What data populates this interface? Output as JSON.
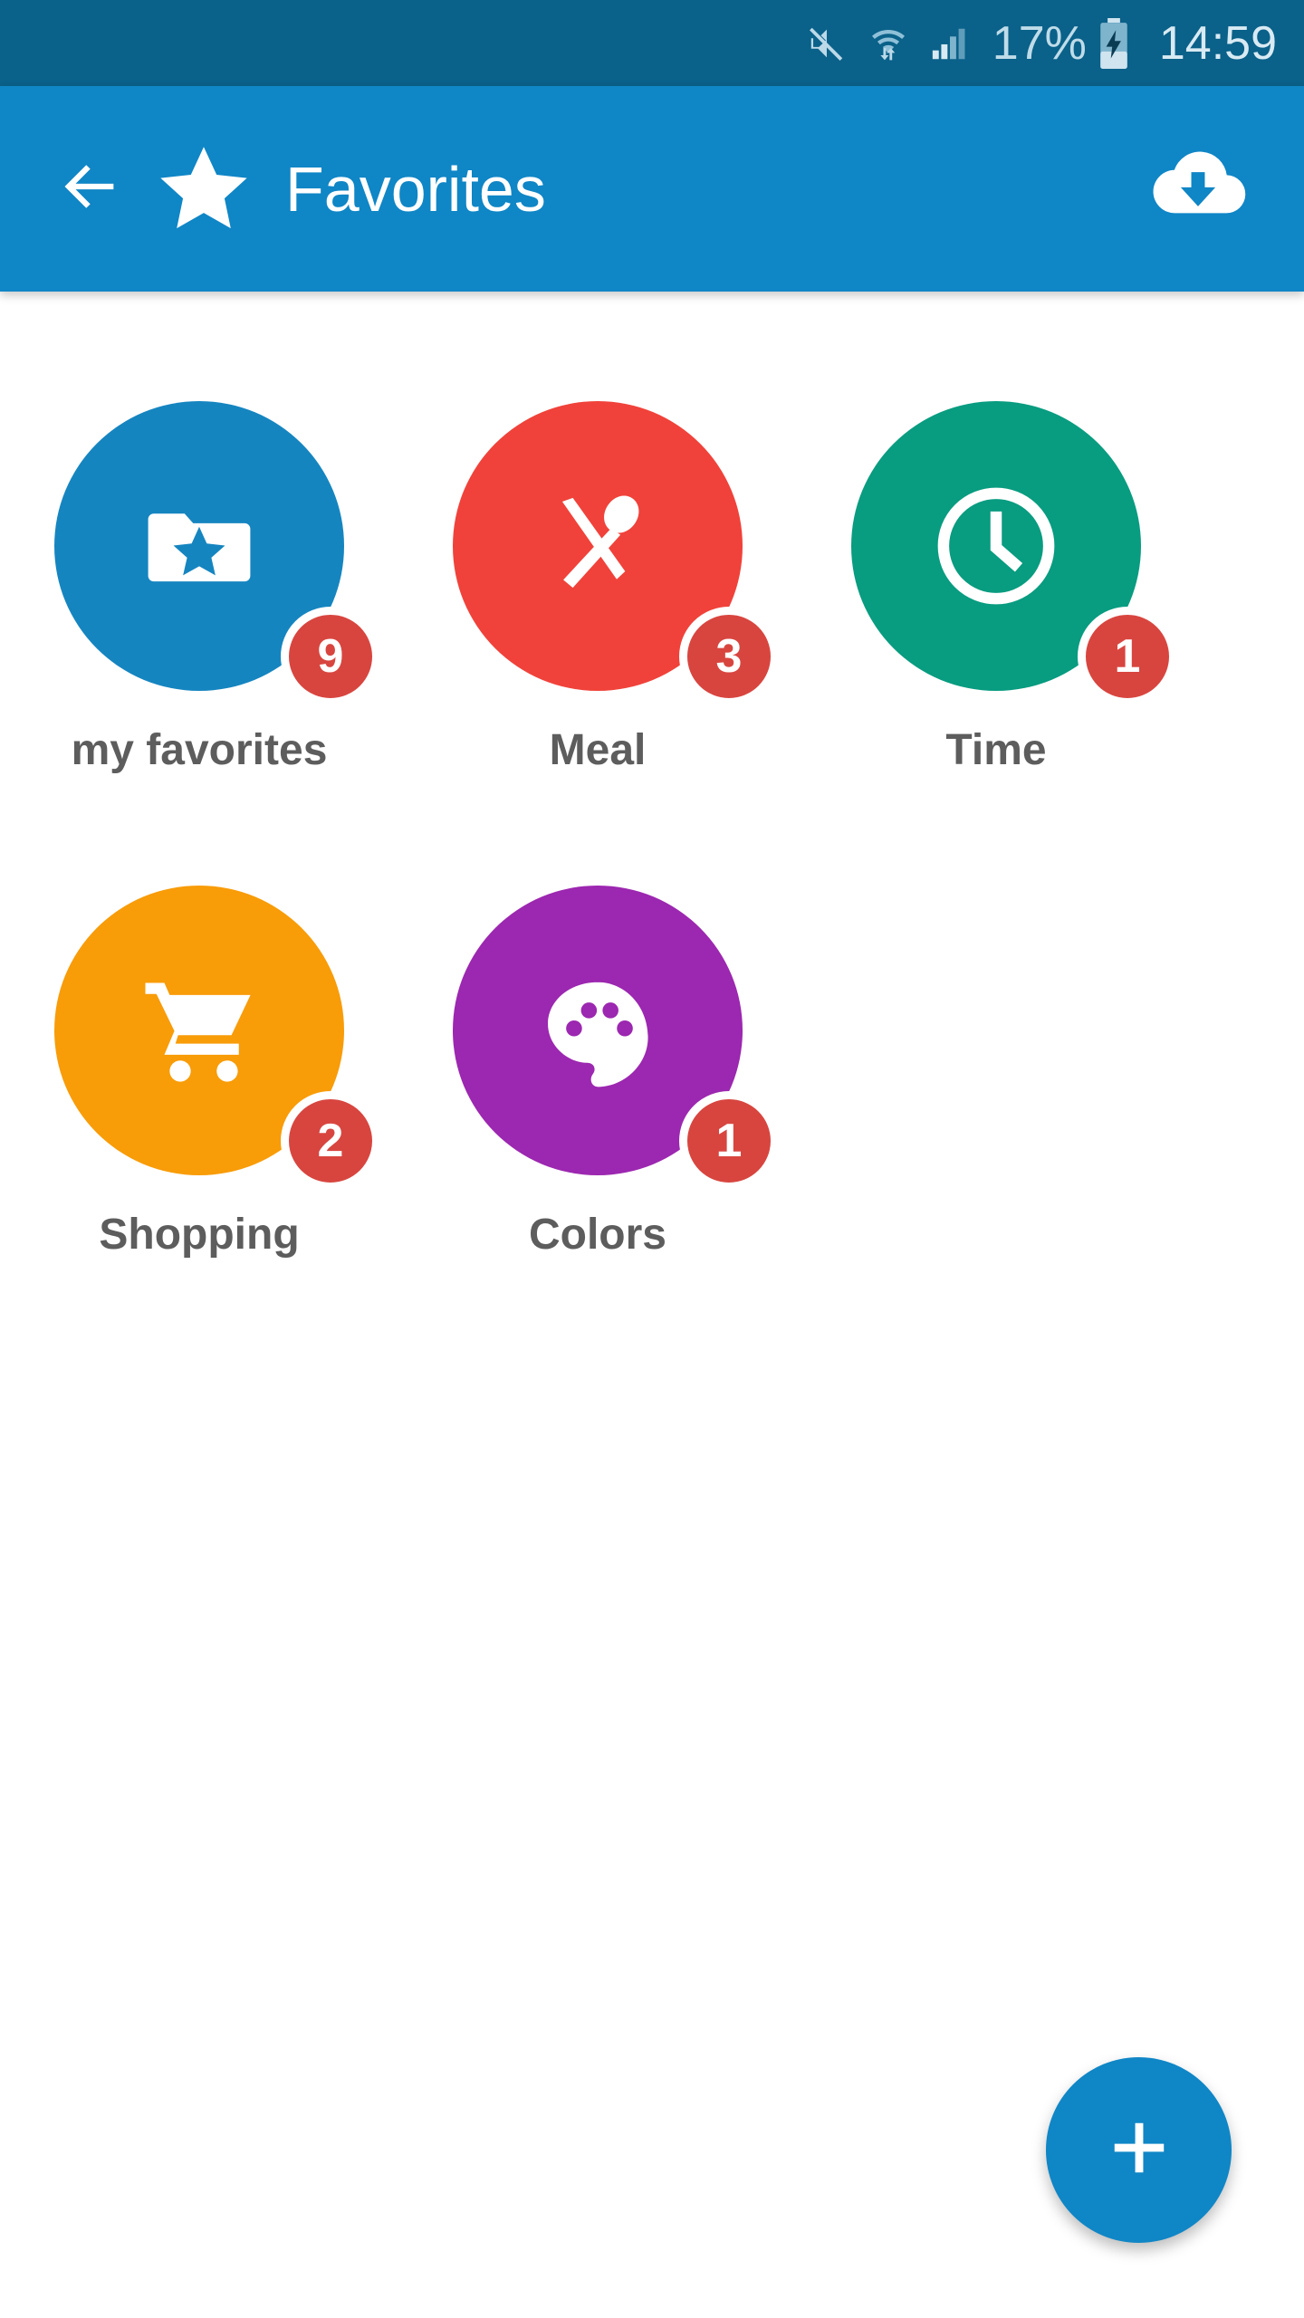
{
  "status_bar": {
    "background": "#0a6189",
    "mute_icon": "mute-icon",
    "wifi_icon": "wifi-transfer-icon",
    "signal_icon": "signal-bars-icon",
    "battery_percent": "17%",
    "battery_icon": "battery-charging-icon",
    "clock": "14:59"
  },
  "app_bar": {
    "background": "#0f86c6",
    "back_icon": "arrow-left-icon",
    "star_icon": "star-icon",
    "title": "Favorites",
    "download_icon": "cloud-download-icon"
  },
  "tiles": [
    {
      "label": "my favorites",
      "badge": "9",
      "color": "#1585c0",
      "icon": "folder-star-icon"
    },
    {
      "label": "Meal",
      "badge": "3",
      "color": "#f0423a",
      "icon": "cutlery-icon"
    },
    {
      "label": "Time",
      "badge": "1",
      "color": "#089c80",
      "icon": "clock-icon"
    },
    {
      "label": "Shopping",
      "badge": "2",
      "color": "#f89c08",
      "icon": "shopping-cart-icon"
    },
    {
      "label": "Colors",
      "badge": "1",
      "color": "#9c27b0",
      "icon": "palette-icon"
    }
  ],
  "fab": {
    "icon": "plus-icon",
    "color": "#0f86c6"
  },
  "colors": {
    "badge_red": "#d8453f",
    "label_gray": "#5d5d5d",
    "page_background": "#ffffff"
  }
}
